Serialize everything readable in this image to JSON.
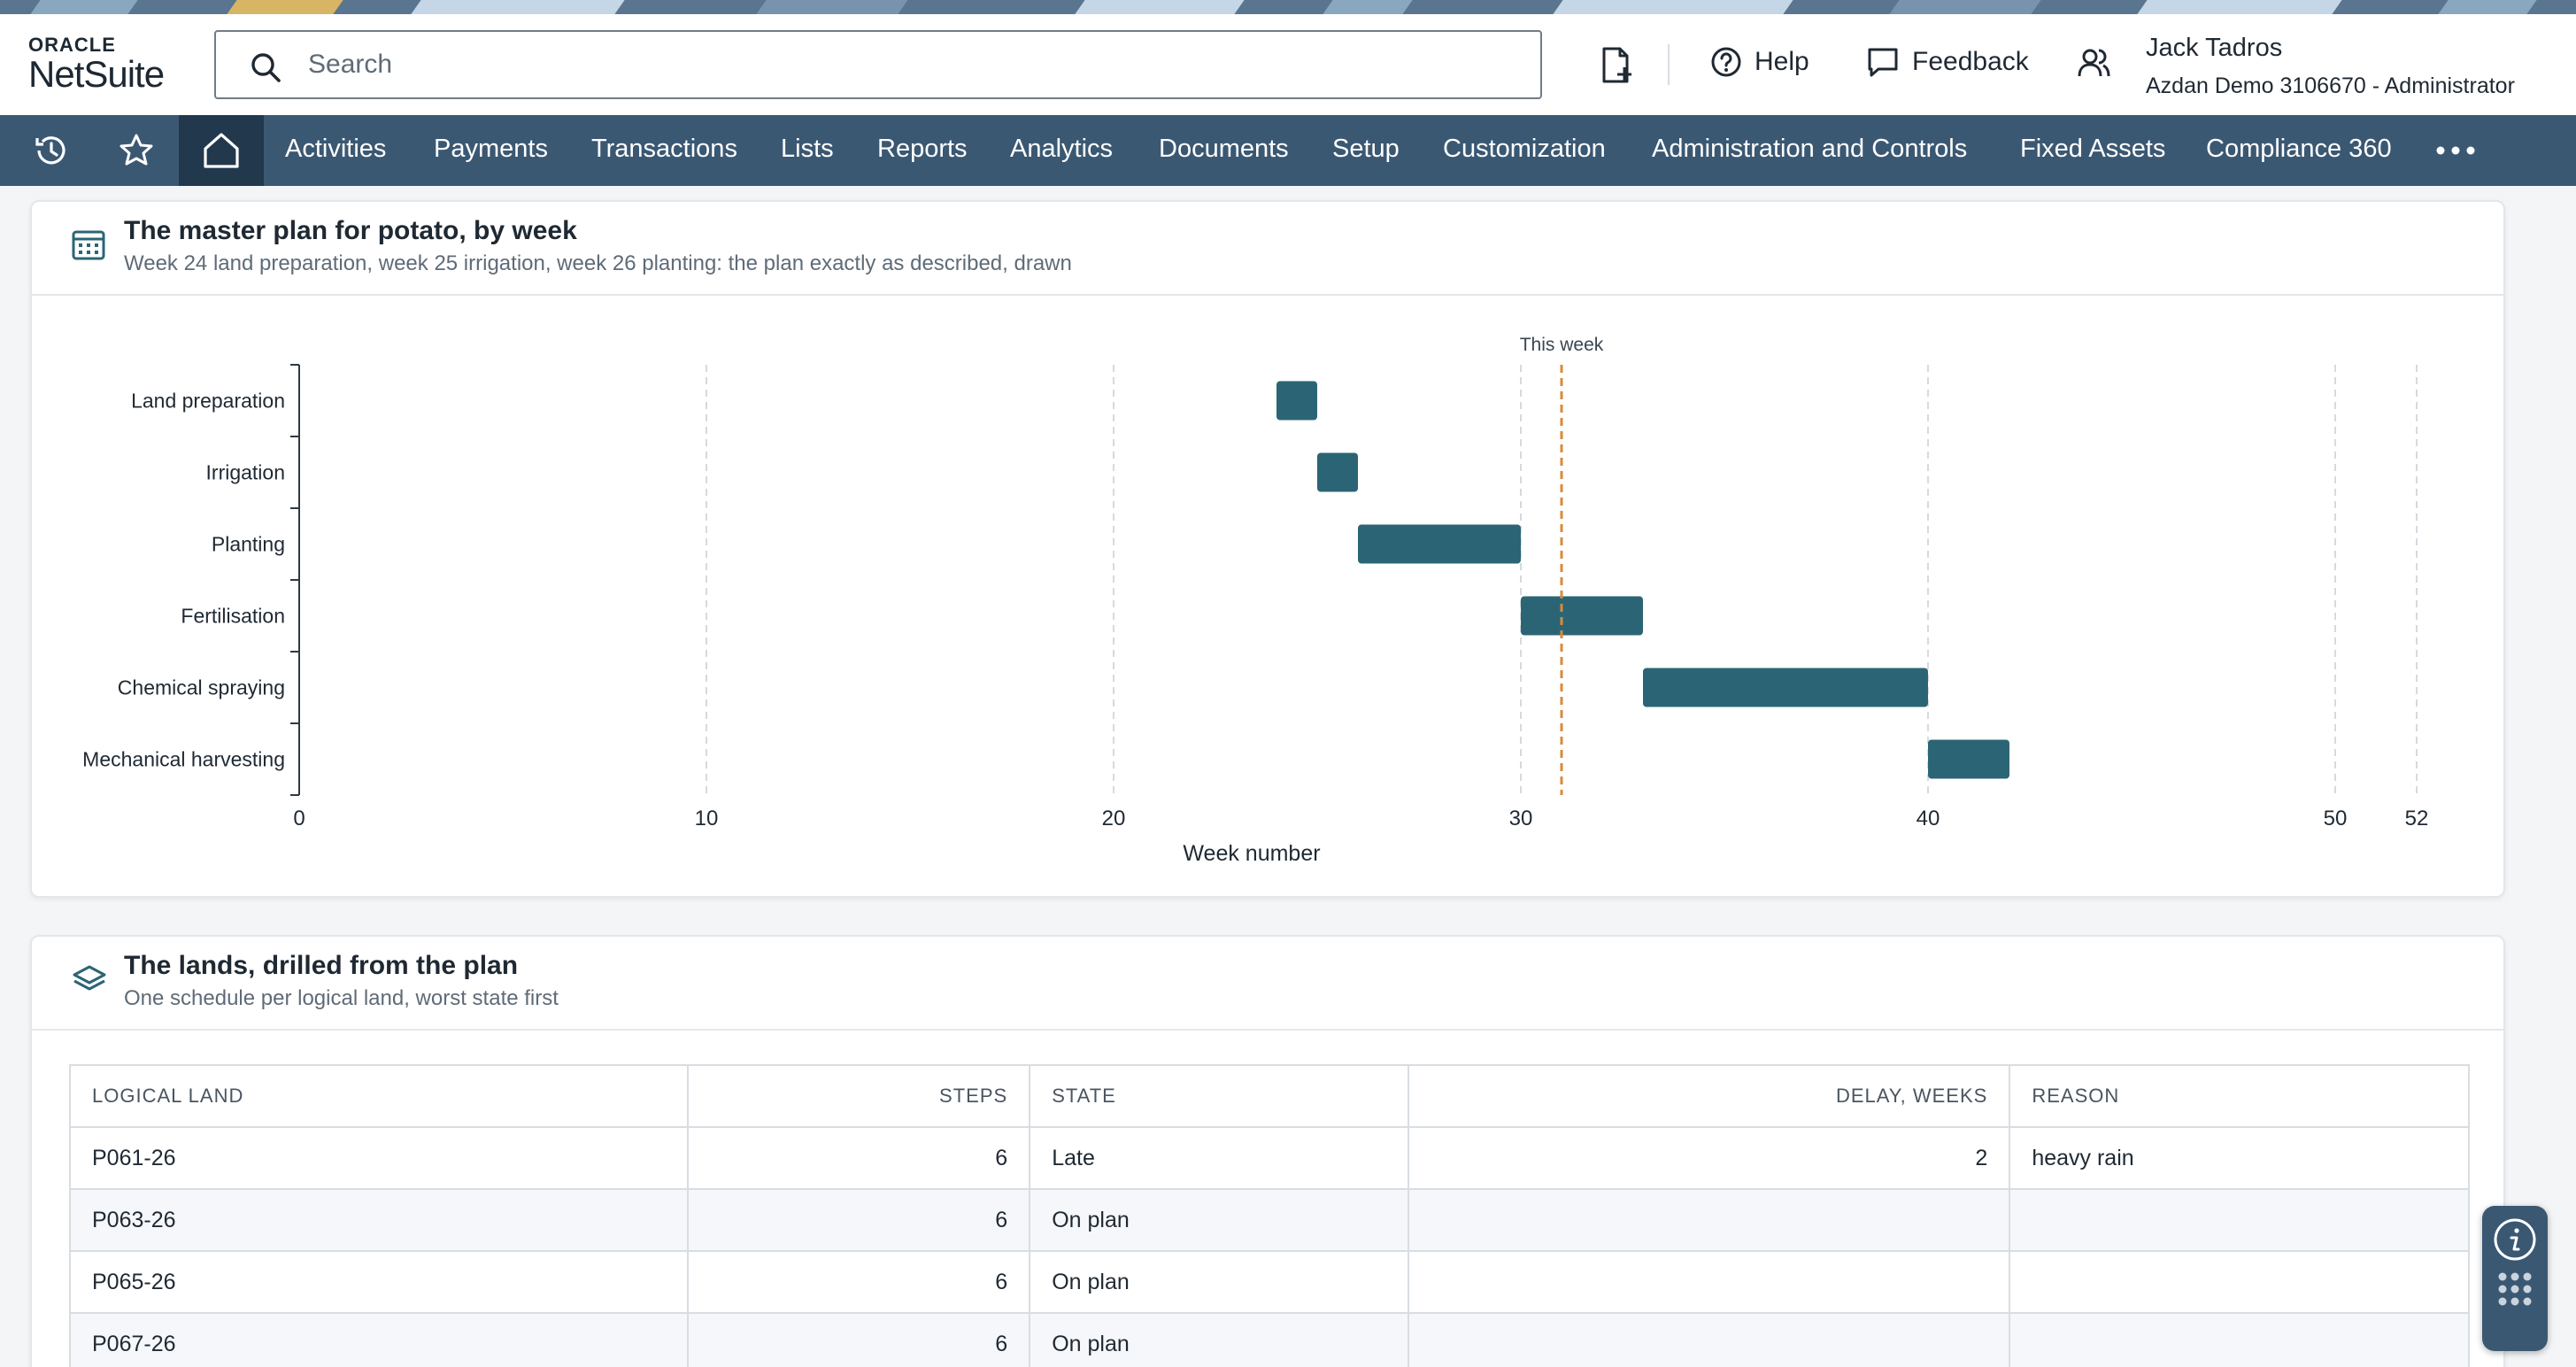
{
  "header": {
    "logo_top": "ORACLE",
    "logo_main": "NetSuite",
    "search_placeholder": "Search",
    "help_label": "Help",
    "feedback_label": "Feedback",
    "user_name": "Jack Tadros",
    "user_role": "Azdan Demo 3106670 - Administrator"
  },
  "nav": {
    "items": [
      "Activities",
      "Payments",
      "Transactions",
      "Lists",
      "Reports",
      "Analytics",
      "Documents",
      "Setup",
      "Customization",
      "Administration and Controls",
      "Fixed Assets",
      "Compliance 360"
    ]
  },
  "plan_card": {
    "title": "The master plan for potato, by week",
    "subtitle": "Week 24 land preparation, week 25 irrigation, week 26 planting: the plan exactly as described, drawn"
  },
  "chart_data": {
    "type": "bar",
    "orientation": "horizontal-gantt",
    "xlabel": "Week number",
    "xlim": [
      0,
      52
    ],
    "xticks": [
      0,
      10,
      20,
      30,
      40,
      50,
      52
    ],
    "grid": "vertical dashed",
    "marker": {
      "label": "This week",
      "x": 31
    },
    "tasks": [
      {
        "name": "Land preparation",
        "start": 24,
        "end": 25
      },
      {
        "name": "Irrigation",
        "start": 25,
        "end": 26
      },
      {
        "name": "Planting",
        "start": 26,
        "end": 30
      },
      {
        "name": "Fertilisation",
        "start": 30,
        "end": 33
      },
      {
        "name": "Chemical spraying",
        "start": 33,
        "end": 40
      },
      {
        "name": "Mechanical harvesting",
        "start": 40,
        "end": 42
      }
    ],
    "colors": {
      "bar": "#2b6575",
      "marker": "#d98b3a"
    }
  },
  "lands_card": {
    "title": "The lands, drilled from the plan",
    "subtitle": "One schedule per logical land, worst state first",
    "columns": [
      "LOGICAL LAND",
      "STEPS",
      "STATE",
      "DELAY, WEEKS",
      "REASON"
    ],
    "rows": [
      [
        "P061-26",
        "6",
        "Late",
        "2",
        "heavy rain"
      ],
      [
        "P063-26",
        "6",
        "On plan",
        "",
        ""
      ],
      [
        "P065-26",
        "6",
        "On plan",
        "",
        ""
      ],
      [
        "P067-26",
        "6",
        "On plan",
        "",
        ""
      ]
    ]
  }
}
